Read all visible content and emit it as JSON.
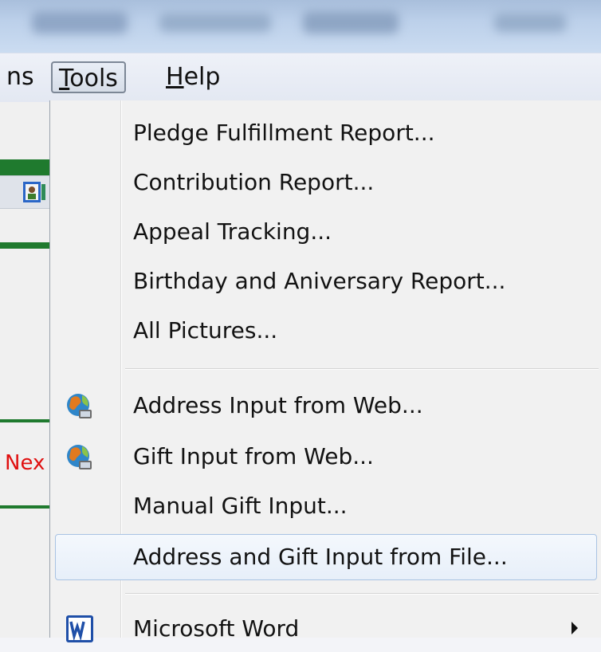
{
  "menubar": {
    "items": [
      {
        "prefix": "",
        "underline": "",
        "rest": "ns"
      },
      {
        "prefix": "",
        "underline": "T",
        "rest": "ools"
      },
      {
        "prefix": "",
        "underline": "H",
        "rest": "elp"
      }
    ]
  },
  "background": {
    "next_label": "Nex"
  },
  "tools_menu": {
    "items": [
      {
        "label": "Pledge Fulfillment Report...",
        "icon": ""
      },
      {
        "label": "Contribution Report...",
        "icon": ""
      },
      {
        "label": "Appeal Tracking...",
        "icon": ""
      },
      {
        "label": "Birthday and Aniversary Report...",
        "icon": ""
      },
      {
        "label": "All Pictures...",
        "icon": ""
      },
      {
        "label": "Address Input from Web...",
        "icon": "globe-icon"
      },
      {
        "label": "Gift Input from Web...",
        "icon": "globe-icon"
      },
      {
        "label": "Manual Gift Input...",
        "icon": ""
      },
      {
        "label": "Address and Gift Input from File...",
        "icon": "",
        "highlighted": true
      },
      {
        "label": "Microsoft Word",
        "icon": "word-icon",
        "submenu": true
      }
    ]
  },
  "colors": {
    "menu_bg": "#f1f1f1",
    "highlight_border": "#a9c3e3",
    "green": "#1f7a2e",
    "red_text": "#e01010"
  }
}
